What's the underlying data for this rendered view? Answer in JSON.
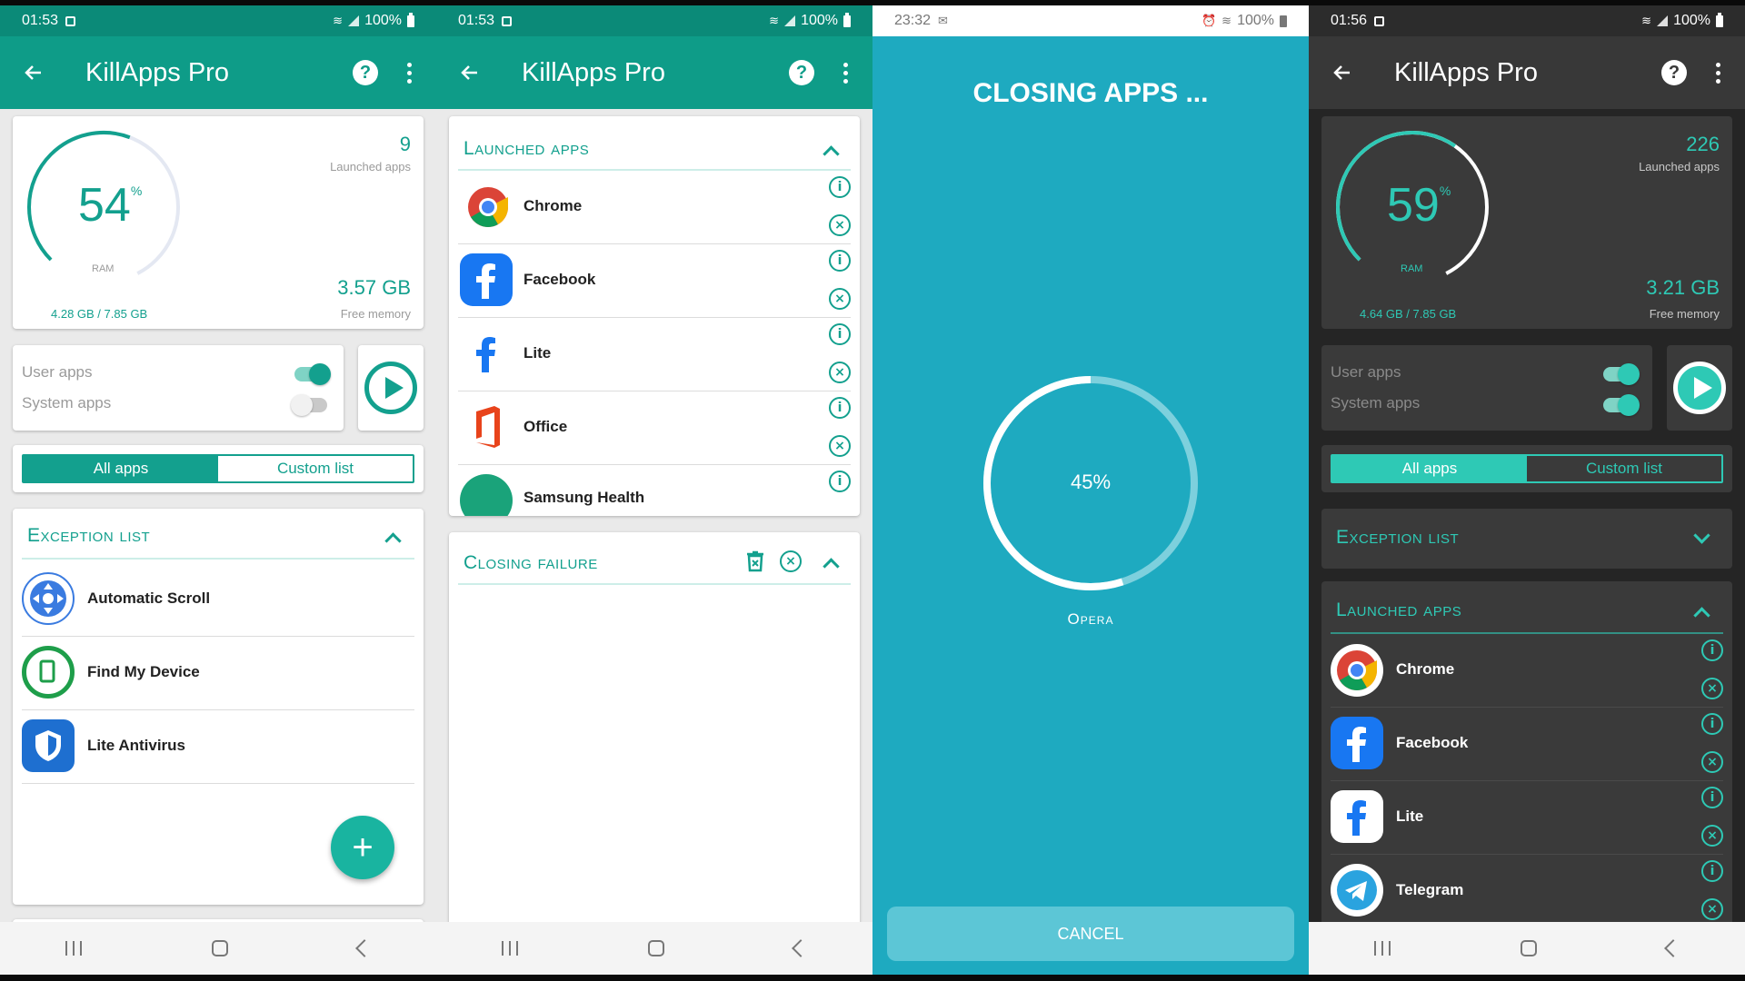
{
  "app_title": "KillApps Pro",
  "colors": {
    "accent": "#13a08e",
    "accent_dark": "#0e9c88",
    "closing_bg": "#1eaac0",
    "dark_bg": "#252525"
  },
  "panel1": {
    "status": {
      "time": "01:53",
      "battery": "100%"
    },
    "ram": {
      "percent": "54",
      "unit": "%",
      "label": "RAM",
      "used": "4.28 GB / 7.85 GB",
      "level": 0.54
    },
    "launched": {
      "count": "9",
      "label": "Launched apps"
    },
    "free": {
      "value": "3.57 GB",
      "label": "Free memory"
    },
    "toggles": {
      "user_label": "User apps",
      "user_on": true,
      "system_label": "System apps",
      "system_on": false
    },
    "segment": {
      "all": "All apps",
      "custom": "Custom list",
      "selected": "All apps"
    },
    "exception": {
      "title": "Exception list",
      "items": [
        {
          "name": "Automatic Scroll",
          "icon": "automatic-scroll-icon"
        },
        {
          "name": "Find My Device",
          "icon": "find-my-device-icon"
        },
        {
          "name": "Lite Antivirus",
          "icon": "lite-antivirus-icon"
        }
      ]
    },
    "fab": "+"
  },
  "panel2": {
    "status": {
      "time": "01:53",
      "battery": "100%"
    },
    "launched": {
      "title": "Launched apps",
      "items": [
        {
          "name": "Chrome",
          "icon": "chrome-icon"
        },
        {
          "name": "Facebook",
          "icon": "facebook-icon"
        },
        {
          "name": "Lite",
          "icon": "facebook-lite-icon"
        },
        {
          "name": "Office",
          "icon": "office-icon"
        },
        {
          "name": "Samsung Health",
          "icon": "samsung-health-icon"
        }
      ]
    },
    "failure": {
      "title": "Closing failure"
    }
  },
  "panel3": {
    "status": {
      "time": "23:32",
      "battery": "100%"
    },
    "title": "CLOSING APPS ...",
    "progress_text": "45%",
    "progress": 0.45,
    "current_app": "Opera",
    "cancel": "CANCEL"
  },
  "panel4": {
    "status": {
      "time": "01:56",
      "battery": "100%"
    },
    "ram": {
      "percent": "59",
      "unit": "%",
      "label": "RAM",
      "used": "4.64 GB / 7.85 GB",
      "level": 0.59
    },
    "launched": {
      "count": "226",
      "label": "Launched apps"
    },
    "free": {
      "value": "3.21 GB",
      "label": "Free memory"
    },
    "toggles": {
      "user_label": "User apps",
      "user_on": true,
      "system_label": "System apps",
      "system_on": true
    },
    "segment": {
      "all": "All apps",
      "custom": "Custom list",
      "selected": "All apps"
    },
    "exception": {
      "title": "Exception list"
    },
    "launched_list": {
      "title": "Launched apps",
      "items": [
        {
          "name": "Chrome",
          "icon": "chrome-icon"
        },
        {
          "name": "Facebook",
          "icon": "facebook-icon"
        },
        {
          "name": "Lite",
          "icon": "facebook-lite-icon"
        },
        {
          "name": "Telegram",
          "icon": "telegram-icon"
        }
      ]
    }
  }
}
